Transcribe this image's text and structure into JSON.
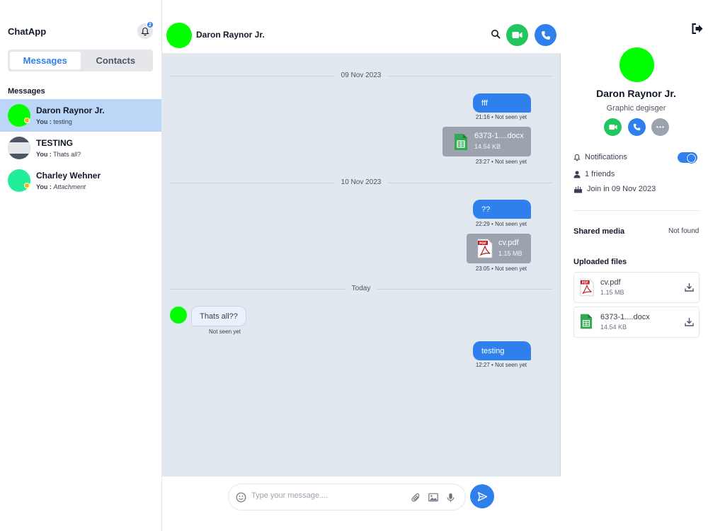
{
  "app": {
    "title": "ChatApp",
    "notification_count": "2"
  },
  "sidebar": {
    "tabs": [
      {
        "label": "Messages"
      },
      {
        "label": "Contacts"
      }
    ],
    "section_label": "Messages",
    "chats": [
      {
        "name": "Daron Raynor Jr.",
        "sender": "You :",
        "preview": "testing"
      },
      {
        "name": "TESTING",
        "sender": "You :",
        "preview": "Thats all?"
      },
      {
        "name": "Charley Wehner",
        "sender": "You :",
        "preview": "Attachment"
      }
    ]
  },
  "chat": {
    "contact_name": "Daron Raynor Jr.",
    "date_separators": [
      "09 Nov 2023",
      "10 Nov 2023",
      "Today"
    ],
    "messages": [
      {
        "text": "fff",
        "meta": "21:16 • Not seen yet"
      },
      {
        "file_name": "6373-1....docx",
        "file_size": "14.54 KB",
        "meta": "23:27 • Not seen yet"
      },
      {
        "text": "??",
        "meta": "22:29 • Not seen yet"
      },
      {
        "file_name": "cv.pdf",
        "file_size": "1.15 MB",
        "meta": "23:05 • Not seen yet"
      },
      {
        "text": "Thats all??",
        "meta": "Not seen yet"
      },
      {
        "text": "testing",
        "meta": "12:27 • Not seen yet"
      }
    ],
    "composer": {
      "placeholder": "Type your message...."
    }
  },
  "profile": {
    "name": "Daron Raynor Jr.",
    "role": "Graphic degisger",
    "notifications_label": "Notifications",
    "notifications_on": true,
    "friends": "1 friends",
    "joined": "Join in 09 Nov 2023",
    "shared_media_label": "Shared media",
    "shared_media_value": "Not found",
    "uploaded_files_label": "Uploaded files",
    "uploaded_files": [
      {
        "name": "cv.pdf",
        "size": "1.15 MB"
      },
      {
        "name": "6373-1....docx",
        "size": "14.54 KB"
      }
    ]
  },
  "colors": {
    "accent": "#2f80ed",
    "online_green": "#00ff00",
    "video_green": "#22c55e",
    "away_yellow": "#f5b800",
    "chat_bg": "#e2e8f0"
  },
  "icons": {
    "notifications": "bell-icon",
    "search": "search-icon",
    "video_call": "video-icon",
    "voice_call": "phone-icon",
    "logout": "logout-icon",
    "more": "more-icon",
    "emoji": "emoji-icon",
    "attach": "paperclip-icon",
    "image": "image-icon",
    "voice": "microphone-icon",
    "send": "send-icon",
    "download": "download-icon"
  }
}
